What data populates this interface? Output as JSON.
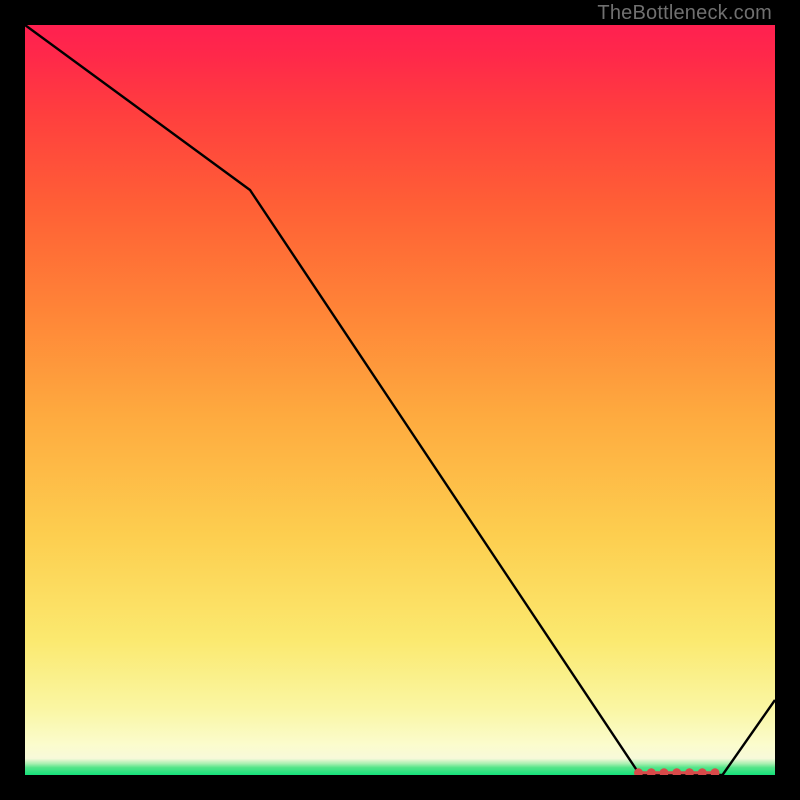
{
  "attribution": "TheBottleneck.com",
  "chart_data": {
    "type": "line",
    "title": "",
    "xlabel": "",
    "ylabel": "",
    "xlim": [
      0,
      100
    ],
    "ylim": [
      0,
      100
    ],
    "x": [
      0,
      30,
      82,
      93,
      100
    ],
    "values": [
      100,
      78,
      0,
      0,
      10
    ],
    "markers_x": [
      81.8,
      83.5,
      85.2,
      86.9,
      88.6,
      90.3,
      92.0
    ],
    "markers_y": [
      0.3,
      0.3,
      0.3,
      0.3,
      0.3,
      0.3,
      0.3
    ],
    "gradient_stops": [
      {
        "offset": 0,
        "color": "#14e07a"
      },
      {
        "offset": 1.0,
        "color": "#55e589"
      },
      {
        "offset": 1.5,
        "color": "#a7efb0"
      },
      {
        "offset": 2.2,
        "color": "#f7f9da"
      },
      {
        "offset": 4,
        "color": "#fbfccd"
      },
      {
        "offset": 9,
        "color": "#faf6a2"
      },
      {
        "offset": 18,
        "color": "#fbe96f"
      },
      {
        "offset": 32,
        "color": "#fdce4f"
      },
      {
        "offset": 48,
        "color": "#feaa3f"
      },
      {
        "offset": 62,
        "color": "#ff8437"
      },
      {
        "offset": 76,
        "color": "#ff5f36"
      },
      {
        "offset": 88,
        "color": "#ff3f3e"
      },
      {
        "offset": 96,
        "color": "#ff284a"
      },
      {
        "offset": 100,
        "color": "#ff2050"
      }
    ]
  }
}
